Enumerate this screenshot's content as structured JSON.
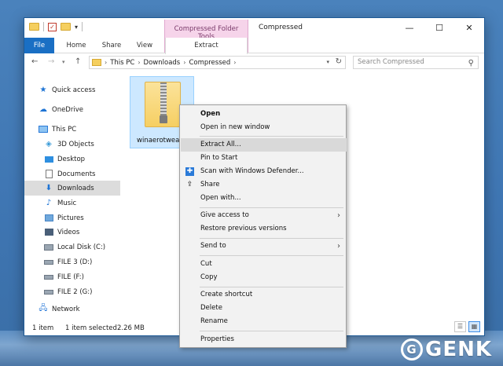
{
  "window": {
    "title": "Compressed",
    "context_tab_group": "Compressed Folder Tools",
    "controls": {
      "minimize": "—",
      "maximize": "☐",
      "close": "✕"
    }
  },
  "ribbon": {
    "tabs": [
      {
        "label": "File"
      },
      {
        "label": "Home"
      },
      {
        "label": "Share"
      },
      {
        "label": "View"
      },
      {
        "label": "Extract"
      }
    ]
  },
  "address": {
    "path": [
      "This PC",
      "Downloads",
      "Compressed"
    ],
    "search_placeholder": "Search Compressed"
  },
  "sidebar": {
    "items": [
      {
        "label": "Quick access",
        "icon": "star-icon"
      },
      {
        "label": "OneDrive",
        "icon": "cloud-icon"
      },
      {
        "label": "This PC",
        "icon": "computer-icon"
      },
      {
        "label": "3D Objects",
        "icon": "cube-icon"
      },
      {
        "label": "Desktop",
        "icon": "desktop-icon"
      },
      {
        "label": "Documents",
        "icon": "document-icon"
      },
      {
        "label": "Downloads",
        "icon": "download-arrow-icon",
        "selected": true
      },
      {
        "label": "Music",
        "icon": "music-note-icon"
      },
      {
        "label": "Pictures",
        "icon": "pictures-icon"
      },
      {
        "label": "Videos",
        "icon": "video-icon"
      },
      {
        "label": "Local Disk (C:)",
        "icon": "drive-icon"
      },
      {
        "label": "FILE 3 (D:)",
        "icon": "drive-icon"
      },
      {
        "label": "FILE (F:)",
        "icon": "drive-icon"
      },
      {
        "label": "FILE 2 (G:)",
        "icon": "drive-icon"
      },
      {
        "label": "Network",
        "icon": "network-icon"
      }
    ]
  },
  "file": {
    "name": "winaerotweak"
  },
  "context_menu": {
    "open": "Open",
    "open_new_window": "Open in new window",
    "extract_all": "Extract All...",
    "pin_to_start": "Pin to Start",
    "scan_defender": "Scan with Windows Defender...",
    "share": "Share",
    "open_with": "Open with...",
    "give_access": "Give access to",
    "restore_versions": "Restore previous versions",
    "send_to": "Send to",
    "cut": "Cut",
    "copy": "Copy",
    "create_shortcut": "Create shortcut",
    "delete": "Delete",
    "rename": "Rename",
    "properties": "Properties"
  },
  "status": {
    "items": "1 item",
    "selected": "1 item selected",
    "size": "2.26 MB"
  },
  "watermark": {
    "text": "GENK"
  },
  "colors": {
    "accent": "#1a6fc4",
    "context_tab": "#f6d4ea",
    "selection": "#cde8ff",
    "menu_highlight": "#d9d9d9"
  }
}
